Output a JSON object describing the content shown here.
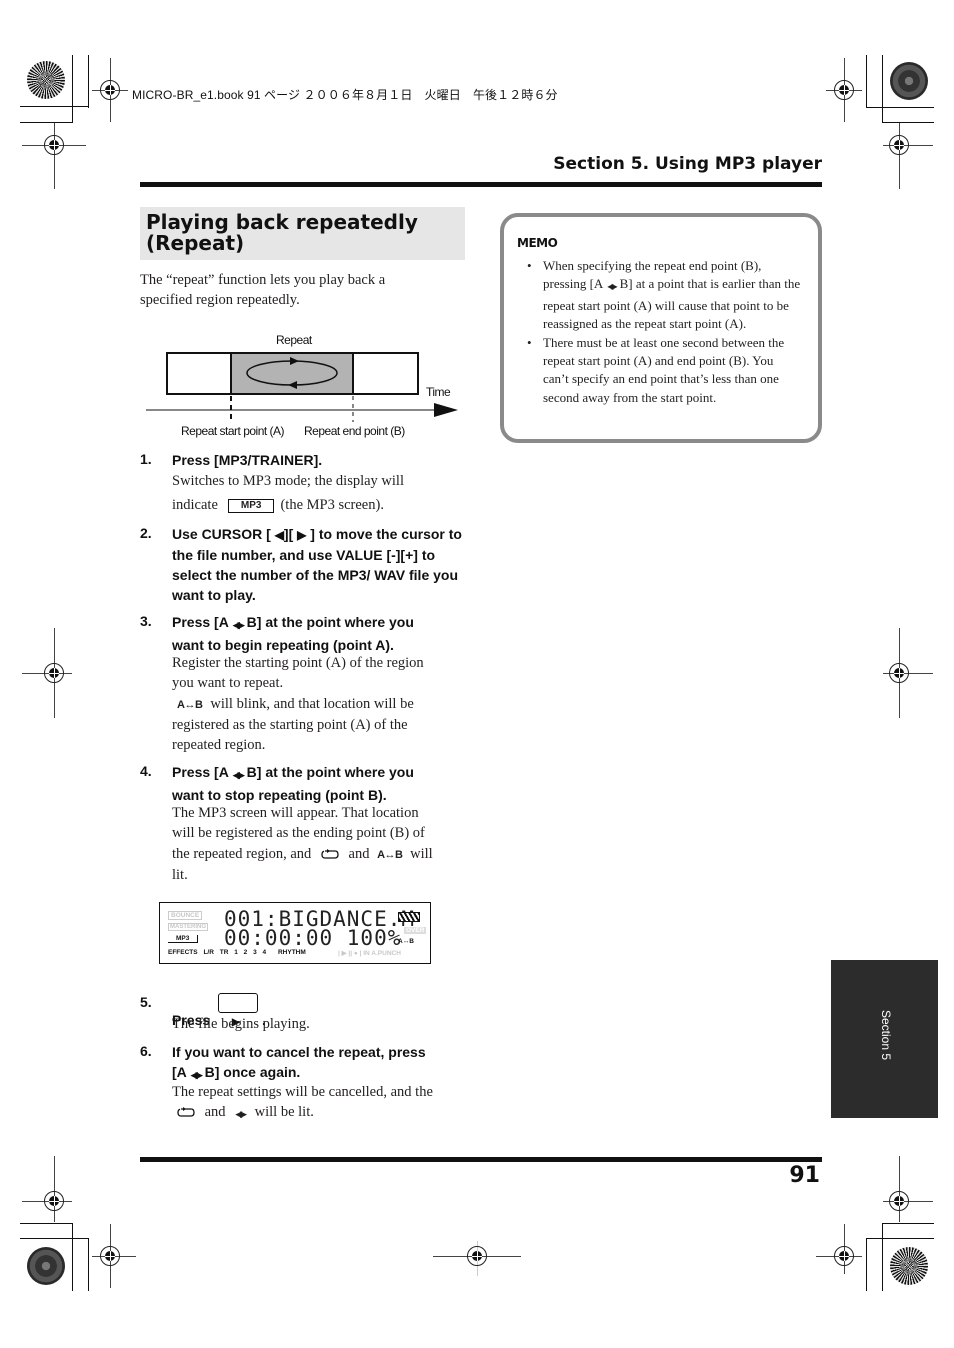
{
  "print_header": {
    "file_info": "MICRO-BR_e1.book  91 ページ  ２００６年８月１日　火曜日　午後１２時６分"
  },
  "running_header": {
    "section_title": "Section 5. Using MP3 player"
  },
  "page_number": "91",
  "side_tab": {
    "label": "Section 5"
  },
  "main": {
    "heading_line1": "Playing back repeatedly",
    "heading_line2": "(Repeat)",
    "intro_line1": "The “repeat” function lets you play back a",
    "intro_line2": "specified region repeatedly."
  },
  "diagram": {
    "repeat_label": "Repeat",
    "time_label": "Time",
    "start_label": "Repeat start point (A)",
    "end_label": "Repeat end point (B)"
  },
  "icons": {
    "ab_icon": "A↔B",
    "mp3_badge": "MP3",
    "arrows": "◀▶",
    "cursor_left": "◀",
    "cursor_right": "▶",
    "play": "▶"
  },
  "steps": [
    {
      "num": "1.",
      "title": "Press [MP3/TRAINER].",
      "body_line1": "Switches to MP3 mode; the display will",
      "body_prefix": "indicate",
      "body_suffix": "(the MP3 screen)."
    },
    {
      "num": "2.",
      "title_a": "Use CURSOR [",
      "title_b": "][",
      "title_c": "] to move the",
      "title_rest": "cursor to the file number, and use VALUE [-][+] to select the number of the MP3/ WAV file you want to play."
    },
    {
      "num": "3.",
      "title_a": "Press [A",
      "title_b": "B] at the point where you",
      "title_line2": "want to begin repeating (point A).",
      "body_line1": "Register the starting point (A) of the region",
      "body_line2": "you want to repeat.",
      "body_line3": "will blink, and that location will be",
      "body_line4": "registered as the starting point (A) of the",
      "body_line5": "repeated region."
    },
    {
      "num": "4.",
      "title_a": "Press [A",
      "title_b": "B] at the point where you",
      "title_line2": "want to stop repeating (point B).",
      "body_line1": "The MP3 screen will appear. That location",
      "body_line2": "will be registered as the ending point (B) of",
      "body_line3a": "the repeated region, and",
      "body_line3b": "and",
      "body_line3c": "will",
      "body_line4": "lit."
    },
    {
      "num": "5.",
      "title_a": "Press",
      "title_b": ".",
      "body": "The file begins playing."
    },
    {
      "num": "6.",
      "title_line1": "If you want to cancel the repeat, press",
      "title_a": "[A",
      "title_b": "B] once again.",
      "body_line1": "The repeat settings will be cancelled, and the",
      "body_line2a": "and",
      "body_line2b": "will be lit."
    }
  ],
  "lcd": {
    "line1": "001:BIGDANCE.M",
    "line2": "00:00:00 100%",
    "bounce": "BOUNCE",
    "mastering": "MASTERING",
    "mp3": "MP3",
    "over": "OVER",
    "ab": "A↔B",
    "bottom_labels": [
      "EFFECTS",
      "L/R",
      "TR",
      "1",
      "2",
      "3",
      "4",
      "RHYTHM"
    ],
    "bottom_faint": "|  ▶  ||  ●  |   IN   A.PUNCH"
  },
  "memo": {
    "logo": "MEMO",
    "items": [
      {
        "line1": "When specifying the repeat end point (B),",
        "line2a": "pressing [A",
        "line2b": "B] at a point that is earlier",
        "rest": "than the repeat start point (A) will cause that point to be reassigned as the repeat start point (A)."
      },
      {
        "text": "There must be at least one second between the repeat start point (A) and end point (B). You can’t specify an end point that’s less than one second away from the start point."
      }
    ]
  }
}
